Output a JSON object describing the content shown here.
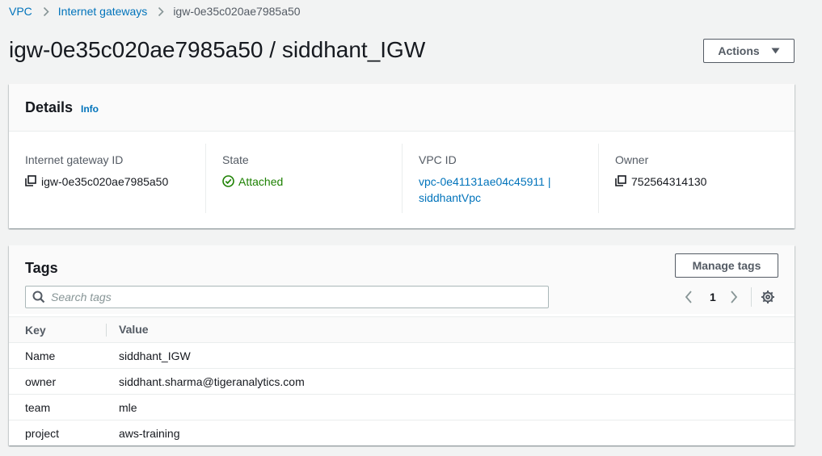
{
  "breadcrumb": {
    "items": [
      "VPC",
      "Internet gateways"
    ],
    "current": "igw-0e35c020ae7985a50"
  },
  "page": {
    "title": "igw-0e35c020ae7985a50 / siddhant_IGW",
    "actions_label": "Actions"
  },
  "details": {
    "title": "Details",
    "info_label": "Info",
    "fields": {
      "gateway_id": {
        "label": "Internet gateway ID",
        "value": "igw-0e35c020ae7985a50"
      },
      "state": {
        "label": "State",
        "value": "Attached"
      },
      "vpc_id": {
        "label": "VPC ID",
        "value": "vpc-0e41131ae04c45911 | siddhantVpc"
      },
      "owner": {
        "label": "Owner",
        "value": "752564314130"
      }
    }
  },
  "tags": {
    "title": "Tags",
    "manage_label": "Manage tags",
    "search_placeholder": "Search tags",
    "page_number": "1",
    "columns": {
      "key": "Key",
      "value": "Value"
    },
    "rows": [
      {
        "key": "Name",
        "value": "siddhant_IGW"
      },
      {
        "key": "owner",
        "value": "siddhant.sharma@tigeranalytics.com"
      },
      {
        "key": "team",
        "value": "mle"
      },
      {
        "key": "project",
        "value": "aws-training"
      }
    ]
  },
  "colors": {
    "link": "#0073bb",
    "success": "#1d8102",
    "text_secondary": "#545b64",
    "background": "#f2f3f3"
  },
  "icons": [
    "chevron-right-icon",
    "caret-down-icon",
    "copy-icon",
    "status-success-icon",
    "search-icon",
    "angle-left-icon",
    "angle-right-icon",
    "settings-icon"
  ]
}
